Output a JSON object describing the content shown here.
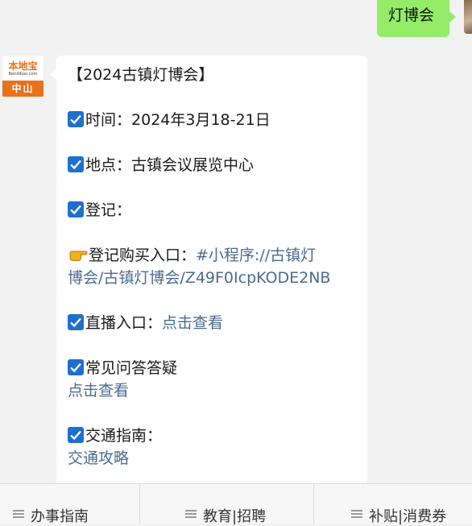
{
  "outgoing": {
    "text": "灯博会"
  },
  "bot": {
    "avatar_line1": "本地宝",
    "avatar_line2": "Bendibao.com",
    "avatar_line3": "中山"
  },
  "message": {
    "title": "【2024古镇灯博会】",
    "time_label": "时间：",
    "time_value": "2024年3月18-21日",
    "place_label": "地点：",
    "place_value": "古镇会议展览中心",
    "register_label": "登记：",
    "buy_label": "登记购买入口：",
    "buy_link_line1": "#小程序://古镇灯",
    "buy_link_line2": "博会/古镇灯博会/Z49F0IcpKODE2NB",
    "live_label": "直播入口：",
    "live_link": "点击查看",
    "faq_label": "常见问答答疑",
    "faq_link": "点击查看",
    "traffic_label": "交通指南：",
    "traffic_link": "交通攻略"
  },
  "menu": {
    "items": [
      "办事指南",
      "教育|招聘",
      "补贴|消费券"
    ]
  },
  "colors": {
    "outgoing_bubble": "#95ec69",
    "link": "#4b6a93",
    "check": "#1e6fd0",
    "brand_orange": "#e8711d"
  }
}
